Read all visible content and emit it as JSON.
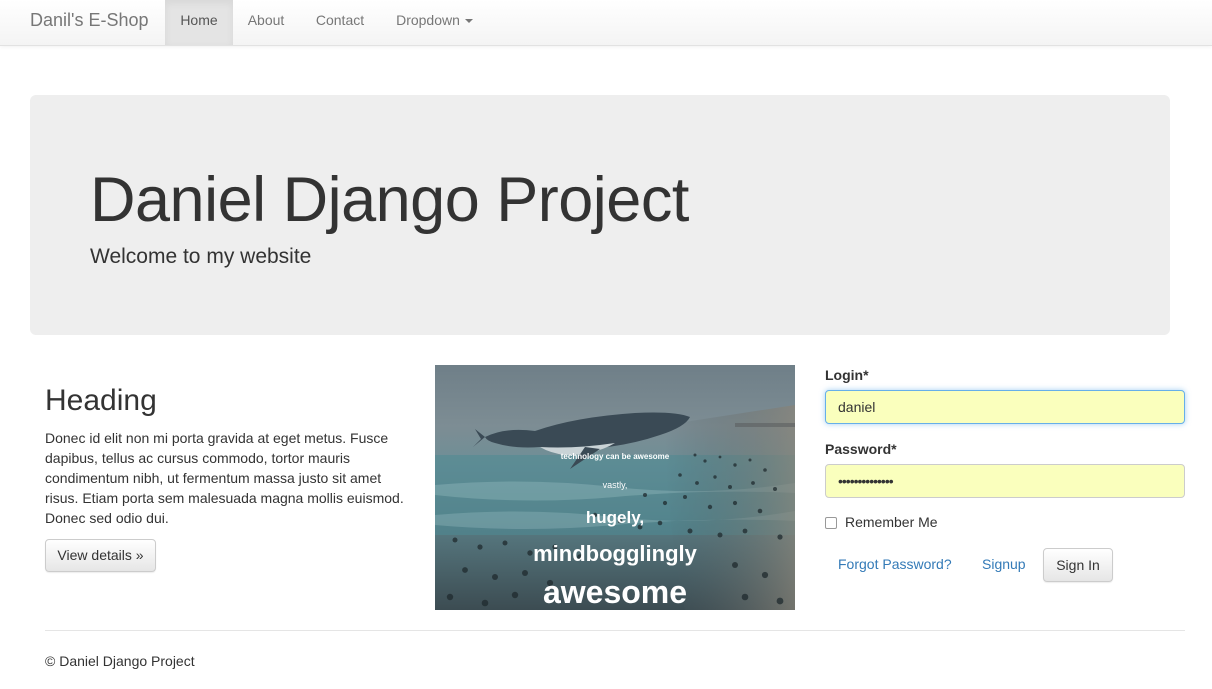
{
  "navbar": {
    "brand": "Danil's E-Shop",
    "items": [
      {
        "label": "Home",
        "active": true
      },
      {
        "label": "About",
        "active": false
      },
      {
        "label": "Contact",
        "active": false
      },
      {
        "label": "Dropdown",
        "active": false
      }
    ],
    "dropdown_icon": "caret-down-icon"
  },
  "jumbotron": {
    "title": "Daniel Django Project",
    "subtitle": "Welcome to my website"
  },
  "feature": {
    "heading": "Heading",
    "text": "Donec id elit non mi porta gravida at eget metus. Fusce dapibus, tellus ac cursus commodo, tortor mauris condimentum nibh, ut fermentum massa justo sit amet risus. Etiam porta sem malesuada magna mollis euismod. Donec sed odio dui.",
    "button": "View details »"
  },
  "image": {
    "line1": "technology can be awesome",
    "line2": "vastly,",
    "line3": "hugely,",
    "line4": "mindbogglingly",
    "line5": "awesome"
  },
  "login_form": {
    "login_label": "Login*",
    "login_value": "daniel",
    "password_label": "Password*",
    "password_value": "••••••••••••••",
    "remember_label": "Remember Me",
    "remember_checked": false,
    "forgot_link": "Forgot Password?",
    "signup_link": "Signup",
    "signin_button": "Sign In"
  },
  "footer": {
    "copyright": "© Daniel Django Project"
  },
  "colors": {
    "link": "#337ab7",
    "autofill": "#faffbd",
    "jumbotron_bg": "#eeeeee"
  }
}
